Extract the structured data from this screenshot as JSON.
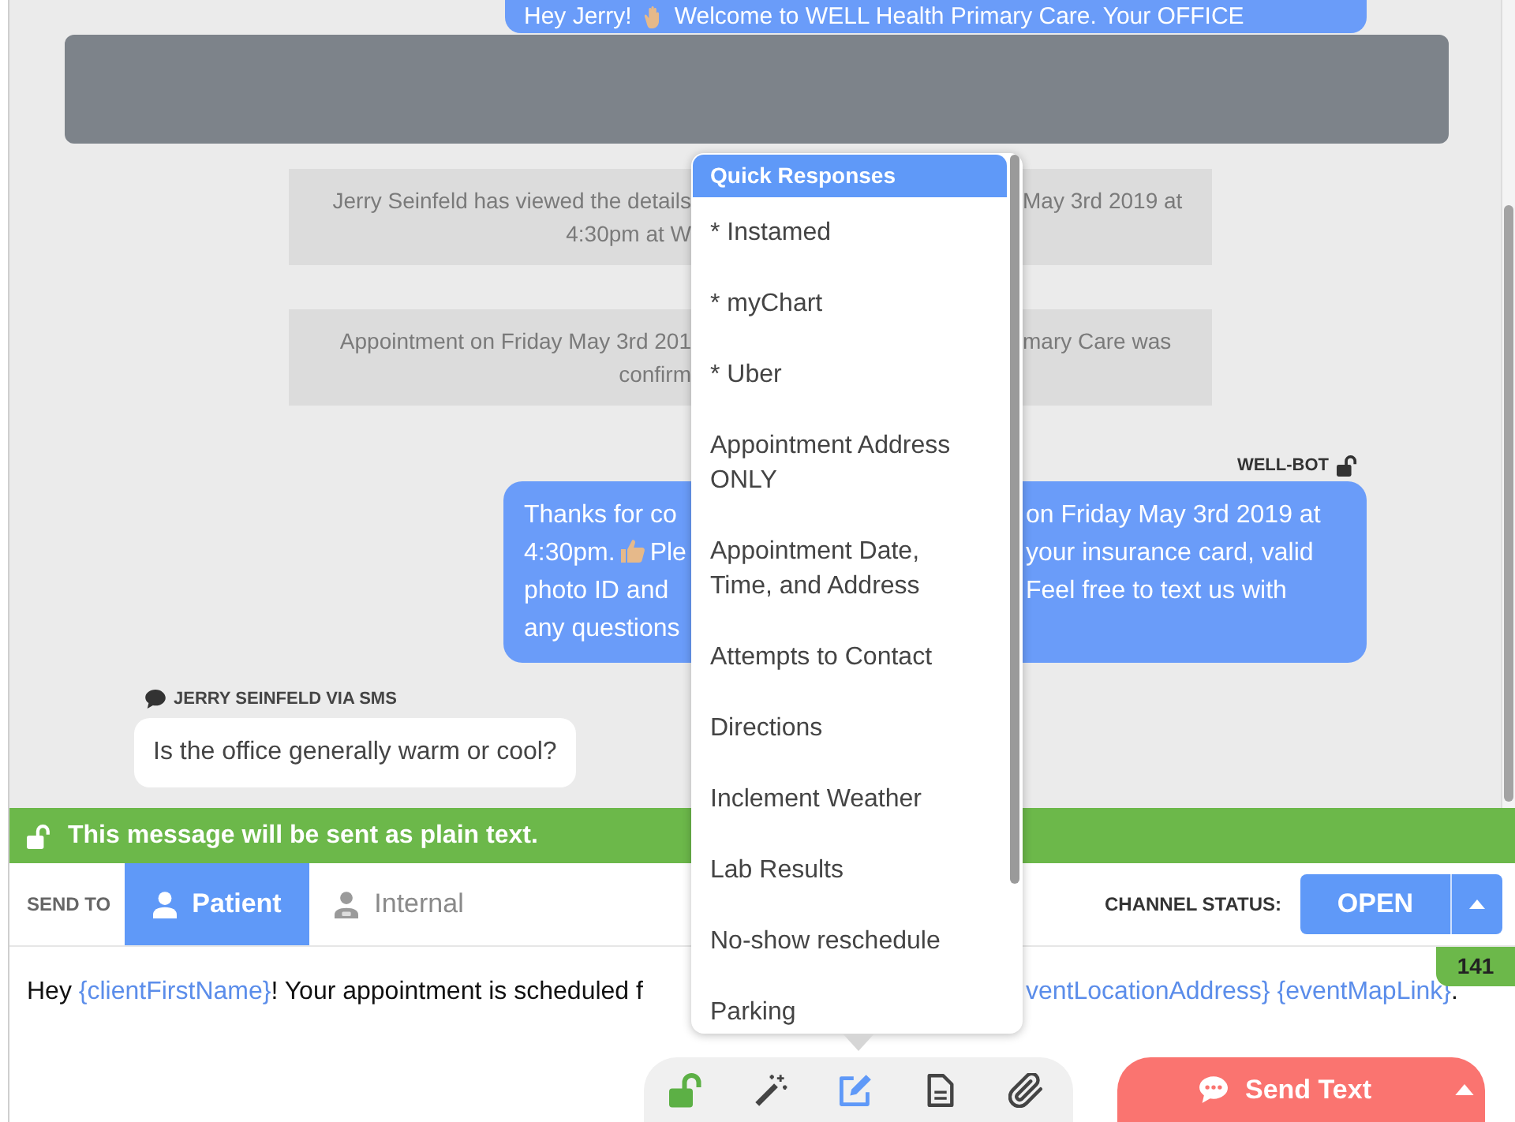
{
  "conversation": {
    "messages": [
      {
        "kind": "outgoing_partial",
        "segments": [
          {
            "kind": "text",
            "text": "Hey Jerry!"
          },
          {
            "kind": "wave"
          },
          {
            "kind": "text",
            "text": "Welcome to WELL Health Primary Care. Your OFFICE"
          }
        ]
      },
      {
        "kind": "redacted"
      },
      {
        "kind": "notice",
        "lines": [
          {
            "left": "Jerry Seinfeld has viewed the details",
            "right": "May 3rd 2019 at"
          },
          {
            "left": "4:30pm at W"
          }
        ]
      },
      {
        "kind": "notice",
        "lines": [
          {
            "left": "Appointment on Friday May 3rd 201",
            "right": "mary Care was"
          },
          {
            "left": "confirm"
          }
        ]
      },
      {
        "kind": "outgoing",
        "sender": "WELL-BOT",
        "lines": [
          {
            "left": "Thanks for co",
            "right": "on Friday May 3rd 2019 at"
          },
          {
            "left": [
              {
                "kind": "text",
                "text": "4:30pm."
              },
              {
                "kind": "thumbs_up"
              },
              {
                "kind": "text",
                "text": "Ple"
              }
            ],
            "right": "your insurance card, valid"
          },
          {
            "left": "photo ID and",
            "right": "Feel free to text us with"
          },
          {
            "left": "any questions"
          }
        ]
      },
      {
        "kind": "incoming",
        "sender": "JERRY SEINFELD VIA SMS",
        "text": "Is the office generally warm or cool?"
      }
    ]
  },
  "quick_responses": {
    "title": "Quick Responses",
    "items": [
      {
        "label": "* Instamed",
        "selected": false
      },
      {
        "label": "* myChart",
        "selected": false
      },
      {
        "label": "* Uber",
        "selected": false
      },
      {
        "label": "Appointment Address ONLY",
        "selected": false
      },
      {
        "label": "Appointment Date, Time, and Address",
        "selected": false
      },
      {
        "label": "Attempts to Contact",
        "selected": false
      },
      {
        "label": "Directions",
        "selected": false
      },
      {
        "label": "Inclement Weather",
        "selected": false
      },
      {
        "label": "Lab Results",
        "selected": false
      },
      {
        "label": "No-show reschedule",
        "selected": false
      },
      {
        "label": "Parking",
        "selected": false
      }
    ]
  },
  "banner": {
    "text": "This message will be sent as plain text."
  },
  "send_to": {
    "label": "SEND TO",
    "tabs": [
      {
        "kind": "person",
        "label": "Patient",
        "selected": true
      },
      {
        "kind": "staff",
        "label": "Internal",
        "selected": false
      }
    ]
  },
  "channel_status": {
    "label": "CHANNEL STATUS:",
    "value": "OPEN"
  },
  "composer": {
    "char_count": "141",
    "value": {
      "left": [
        {
          "kind": "text",
          "text": "Hey "
        },
        {
          "kind": "variable",
          "text": "{clientFirstName}"
        },
        {
          "kind": "text",
          "text": "! Your appointment is scheduled f"
        }
      ],
      "right": [
        {
          "kind": "variable",
          "text": "ventLocationAddress} {eventMapLink}"
        },
        {
          "kind": "text",
          "text": "."
        }
      ]
    }
  },
  "toolbar": [
    {
      "kind": "lock",
      "selected": false
    },
    {
      "kind": "wand",
      "selected": false
    },
    {
      "kind": "compose",
      "selected": true
    },
    {
      "kind": "document",
      "selected": false
    },
    {
      "kind": "attach",
      "selected": false
    }
  ],
  "send_button": {
    "label": "Send Text"
  }
}
